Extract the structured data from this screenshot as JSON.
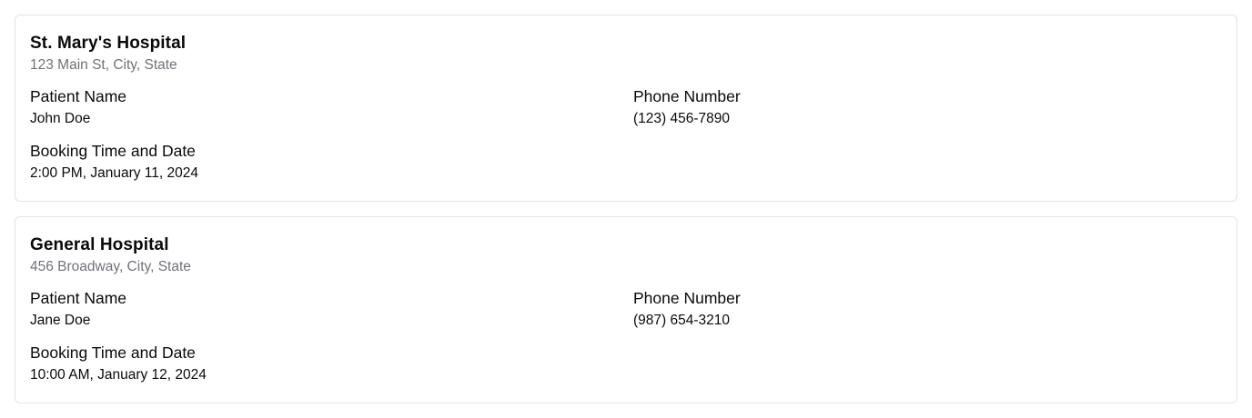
{
  "appointments": [
    {
      "hospital_name": "St. Mary's Hospital",
      "address": "123 Main St, City, State",
      "patient_name_label": "Patient Name",
      "patient_name": "John Doe",
      "phone_label": "Phone Number",
      "phone": "(123) 456-7890",
      "booking_label": "Booking Time and Date",
      "booking": "2:00 PM, January 11, 2024"
    },
    {
      "hospital_name": "General Hospital",
      "address": "456 Broadway, City, State",
      "patient_name_label": "Patient Name",
      "patient_name": "Jane Doe",
      "phone_label": "Phone Number",
      "phone": "(987) 654-3210",
      "booking_label": "Booking Time and Date",
      "booking": "10:00 AM, January 12, 2024"
    }
  ]
}
